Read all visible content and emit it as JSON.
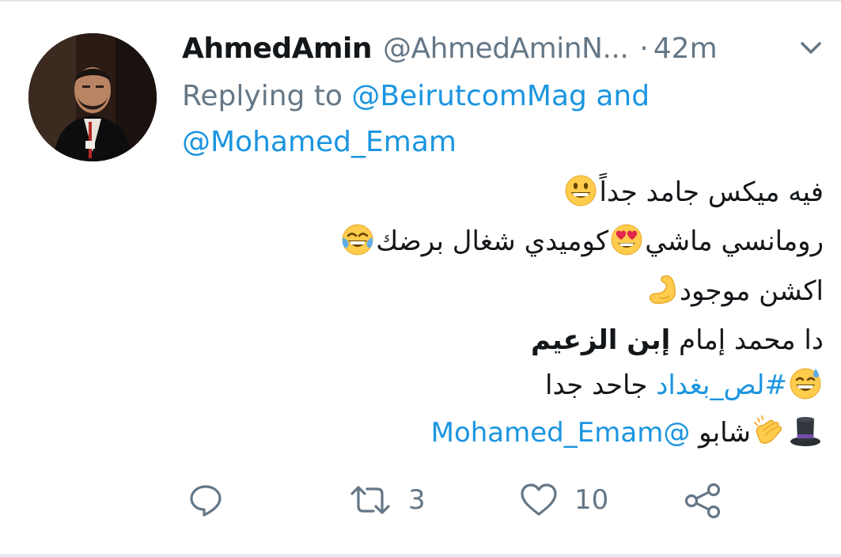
{
  "tweet": {
    "display_name": "AhmedAmin",
    "handle": "@AhmedAminN...",
    "separator": "·",
    "time": "42m",
    "replying_prefix": "Replying to",
    "reply_mention_1": "@BeirutcomMag",
    "reply_and": "and",
    "reply_mention_2": "@Mohamed_Emam",
    "body": {
      "line1": "فيه ميكس جامد جداً",
      "line2_part1": "رومانسي ماشي",
      "line2_part2": "كوميدي شغال برضك",
      "line3": "اكشن موجود",
      "line4_part1": "دا محمد إمام ",
      "line4_part2": "إبن الزعيم",
      "line5_hashtag": "#لص_بغداد",
      "line5_text": "جاحد جدا",
      "line6_text": "شابو",
      "line6_mention": "@Mohamed_Emam"
    },
    "emojis": [
      "grinning-face",
      "heart-eyes-face",
      "tears-of-joy-face",
      "flexed-biceps",
      "grinning-sweat-face",
      "clapping-hands",
      "top-hat"
    ],
    "actions": {
      "retweet_count": "3",
      "like_count": "10"
    }
  },
  "colors": {
    "text": "#14171a",
    "muted": "#657786",
    "link": "#1b95e0",
    "divider": "#e1e8ed"
  }
}
